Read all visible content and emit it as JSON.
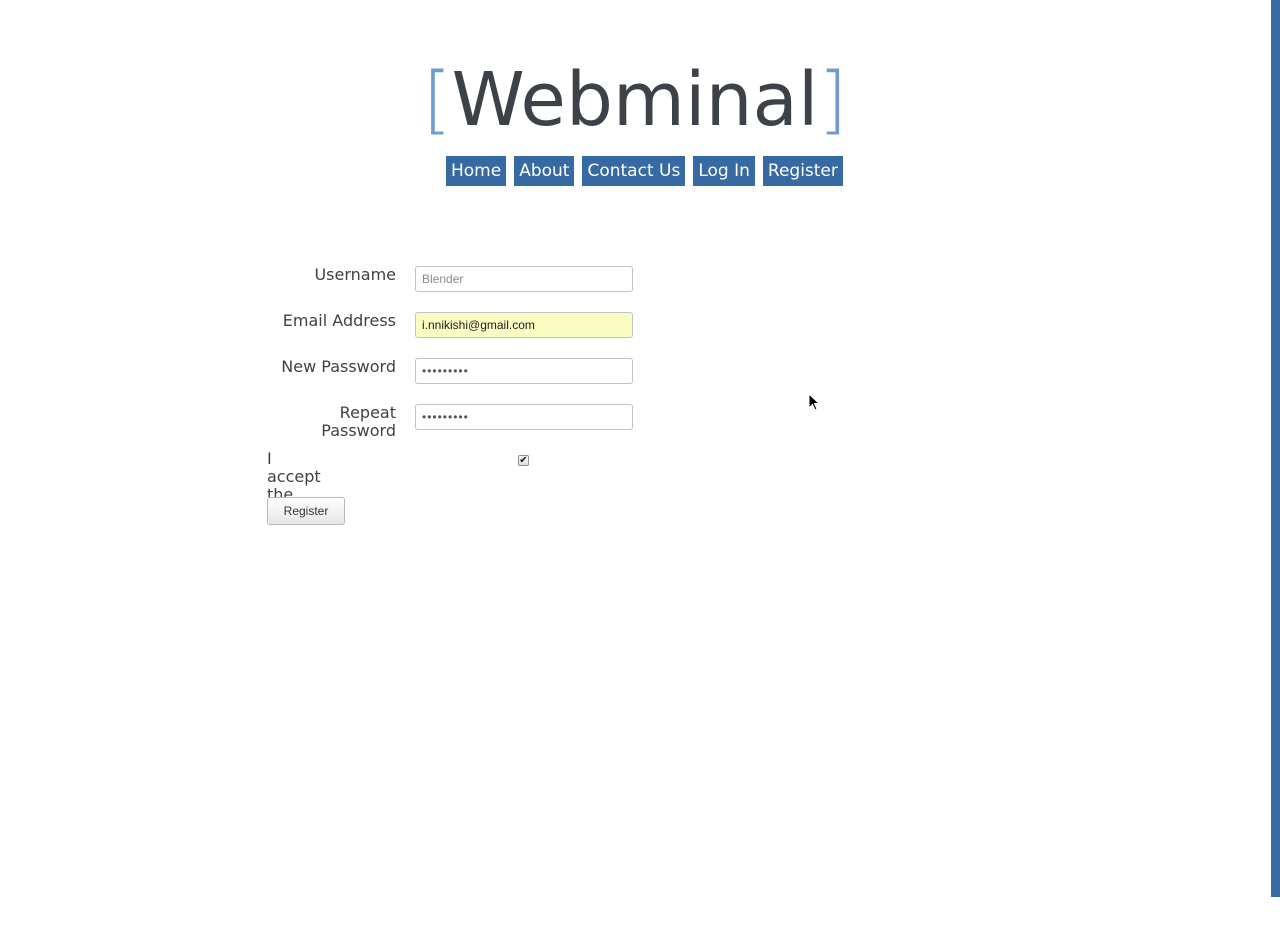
{
  "site": {
    "logo_open_bracket": "[",
    "logo_text": "Webminal",
    "logo_close_bracket": "]"
  },
  "nav": {
    "items": [
      {
        "label": "Home"
      },
      {
        "label": "About"
      },
      {
        "label": "Contact Us"
      },
      {
        "label": "Log In"
      },
      {
        "label": "Register"
      }
    ]
  },
  "form": {
    "username": {
      "label": "Username",
      "value": "",
      "placeholder": "Blender"
    },
    "email": {
      "label": "Email Address",
      "value": "i.nnikishi@gmail.com"
    },
    "new_password": {
      "label": "New Password",
      "value": "•••••••••"
    },
    "repeat_password": {
      "label_line1": "Repeat",
      "label_line2": "Password",
      "value": "•••••••••"
    },
    "tos": {
      "label": "I accept the TOS",
      "checked": true,
      "check_glyph": "✔"
    },
    "submit_label": "Register"
  },
  "colors": {
    "accent": "#376aa3",
    "bracket": "#6f9ccd",
    "text": "#3d4148",
    "autofill_bg": "#fafcc2"
  },
  "icons": {
    "cursor": "mouse-pointer-icon",
    "checkmark": "checkmark-icon"
  }
}
